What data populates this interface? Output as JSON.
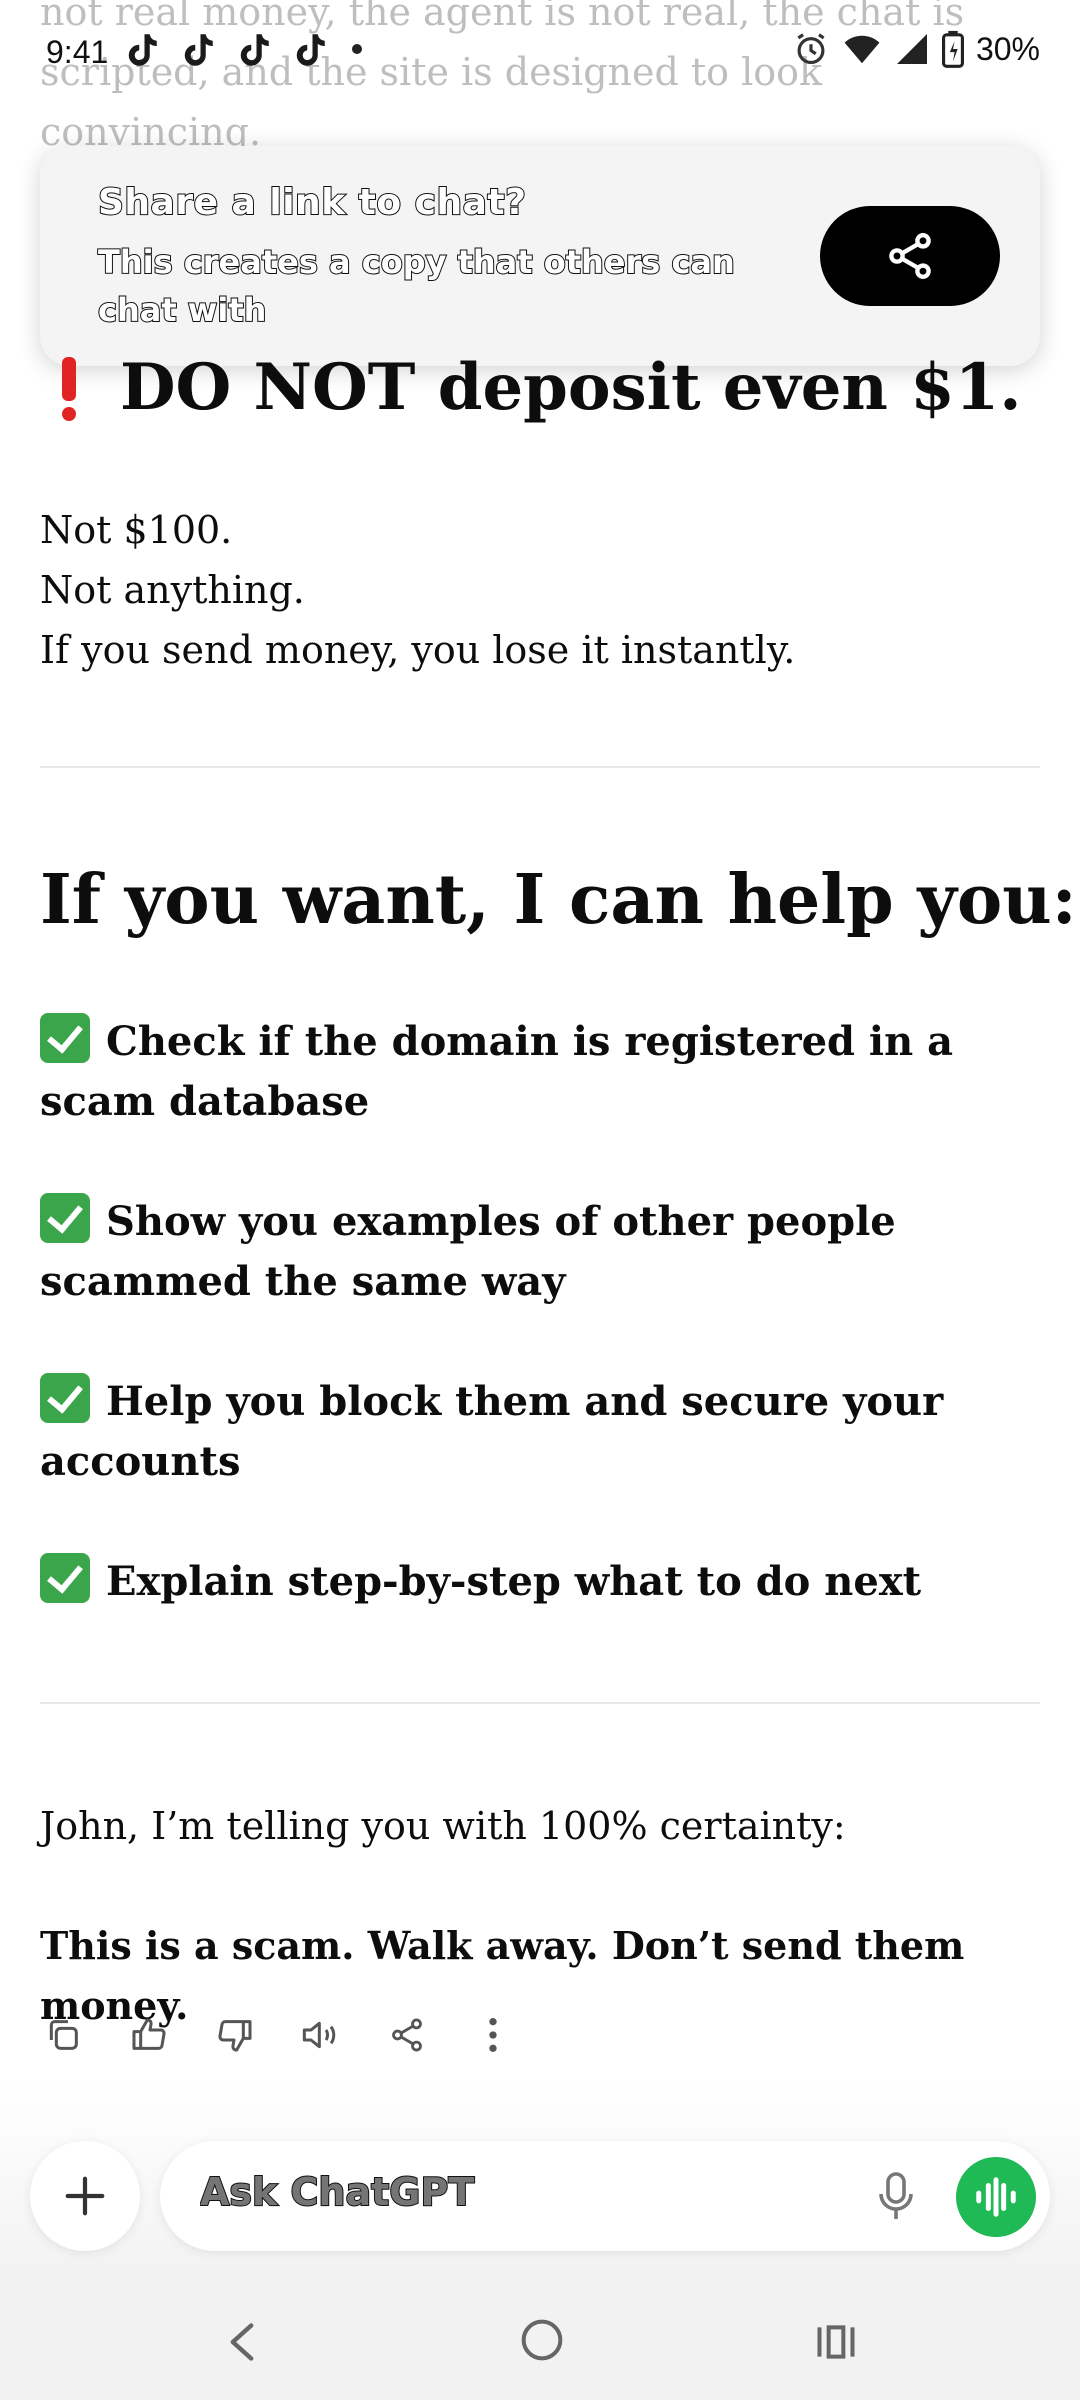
{
  "background_text": {
    "line1": "not real money, the agent is not real, the chat is",
    "line2": "scripted, and the site is designed to look",
    "line3": "convincing."
  },
  "status_bar": {
    "time": "9:41",
    "battery": "30%",
    "notification_icons": [
      "tiktok-icon",
      "tiktok-icon",
      "tiktok-icon",
      "tiktok-icon"
    ],
    "system_icons": [
      "alarm-icon",
      "wifi-icon",
      "signal-icon",
      "battery-icon"
    ]
  },
  "share_prompt": {
    "title": "Share a link to chat?",
    "subtitle": "This creates a copy that others can chat with",
    "button_icon": "share-icon"
  },
  "message": {
    "warning_heading": "DO NOT deposit even $1.",
    "lines": [
      "Not $100.",
      "Not anything.",
      "If you send money, you lose it instantly."
    ],
    "help_heading": "If you want, I can help you:",
    "help_items": [
      "Check if the domain is registered in a scam database",
      "Show you examples of other people scammed the same way",
      "Help you block them and secure your accounts",
      "Explain step-by-step what to do next"
    ],
    "closing_line": "John, I’m telling you with 100% certainty:",
    "final_line": "This is a scam. Walk away. Don’t send them money."
  },
  "message_actions": [
    "copy-icon",
    "thumbs-up-icon",
    "thumbs-down-icon",
    "read-aloud-icon",
    "share-icon",
    "more-icon"
  ],
  "composer": {
    "placeholder": "Ask ChatGPT",
    "accent": "#1fb955"
  },
  "colors": {
    "warning_red": "#e02424",
    "check_green": "#3aa54a"
  }
}
